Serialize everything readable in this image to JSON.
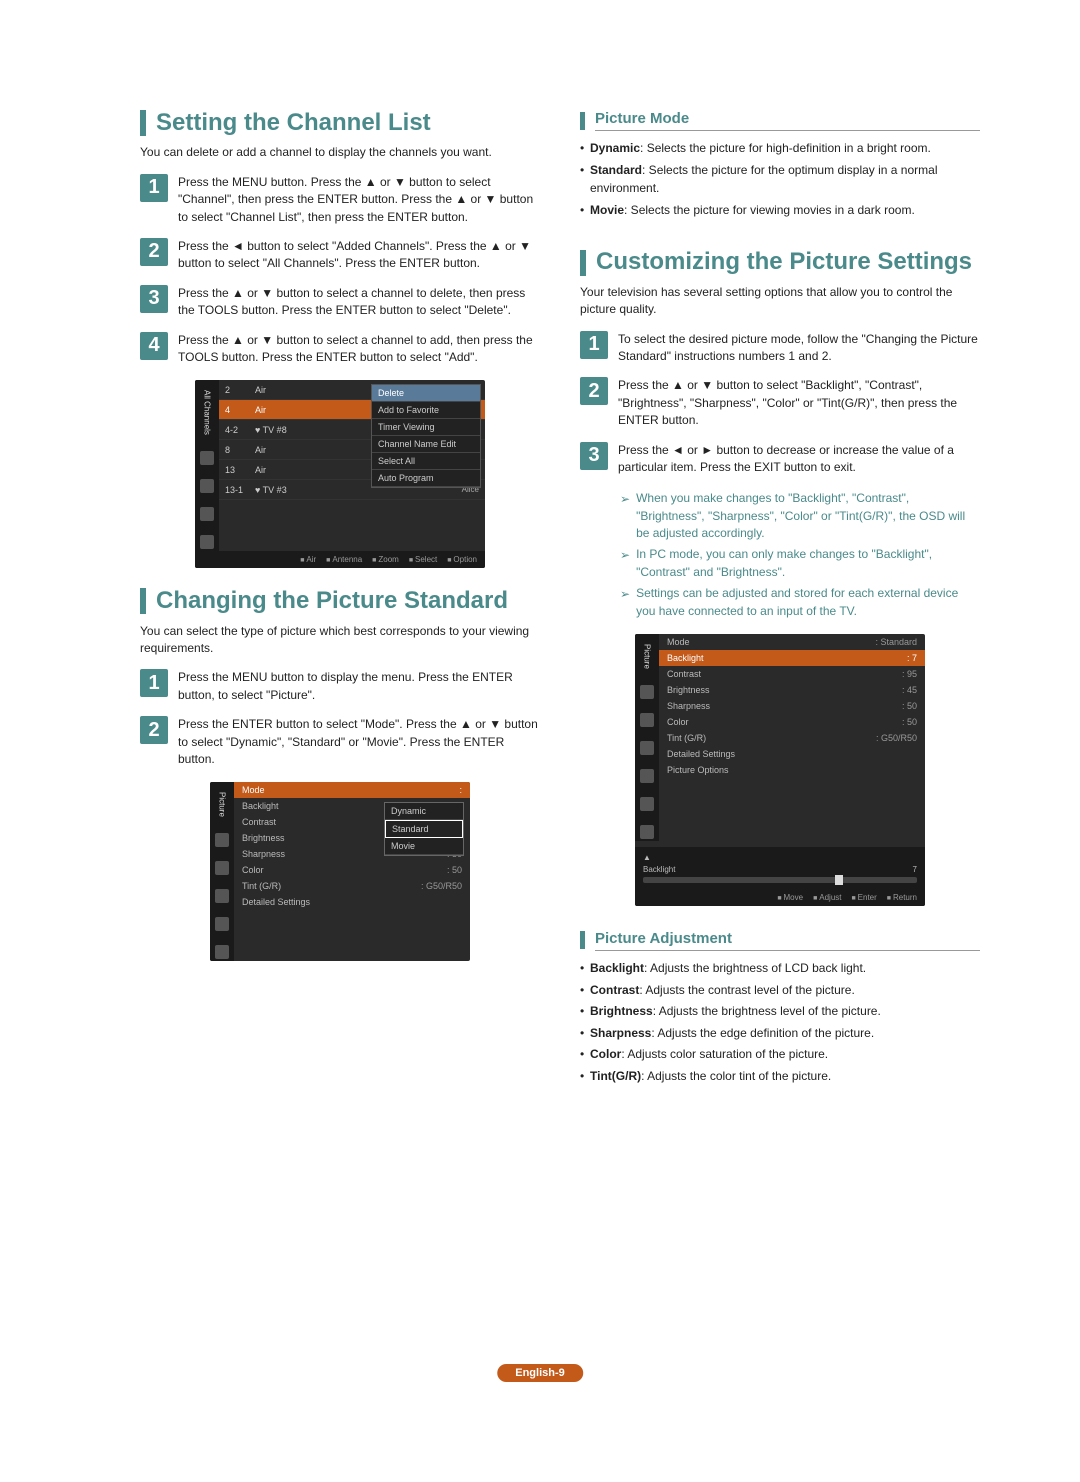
{
  "left": {
    "section1": {
      "title": "Setting the Channel List",
      "intro": "You can delete or add a channel to display the channels you want.",
      "steps": [
        "Press the MENU button. Press the ▲ or ▼ button to select \"Channel\", then press the ENTER button. Press the ▲ or ▼ button to select \"Channel List\", then press the ENTER button.",
        "Press the ◄ button to select \"Added Channels\". Press the ▲ or ▼ button to select \"All Channels\". Press the ENTER button.",
        "Press the ▲ or ▼ button to select a channel to delete, then press the TOOLS button. Press the ENTER button to select \"Delete\".",
        "Press the ▲ or ▼ button to select a channel to add, then press the TOOLS button. Press the ENTER button to select \"Add\"."
      ],
      "osd": {
        "side_label": "All Channels",
        "rows": [
          {
            "c1": "2",
            "c2": "Air",
            "c3": ""
          },
          {
            "c1": "4",
            "c2": "Air",
            "c3": "",
            "hl": true
          },
          {
            "c1": "4-2",
            "c2": "♥ TV #8",
            "c3": ""
          },
          {
            "c1": "8",
            "c2": "Air",
            "c3": ""
          },
          {
            "c1": "13",
            "c2": "Air",
            "c3": ""
          },
          {
            "c1": "13-1",
            "c2": "♥ TV #3",
            "c3": "Alice"
          }
        ],
        "menu": [
          "Delete",
          "Add to Favorite",
          "Timer Viewing",
          "Channel Name Edit",
          "Select All",
          "Auto Program"
        ],
        "footer": [
          "Air",
          "Antenna",
          "Zoom",
          "Select",
          "Option"
        ]
      }
    },
    "section2": {
      "title": "Changing the Picture Standard",
      "intro": "You can select the type of picture which best corresponds to your viewing requirements.",
      "steps": [
        "Press the MENU button to display the menu. Press the ENTER button, to select \"Picture\".",
        "Press the ENTER button to select \"Mode\". Press the ▲ or ▼ button to select \"Dynamic\", \"Standard\" or \"Movie\". Press the ENTER button."
      ],
      "osd": {
        "side_label": "Picture",
        "header": "Mode",
        "rows": [
          {
            "lbl": "Backlight",
            "val": ""
          },
          {
            "lbl": "Contrast",
            "val": ""
          },
          {
            "lbl": "Brightness",
            "val": ""
          },
          {
            "lbl": "Sharpness",
            "val": ": 50"
          },
          {
            "lbl": "Color",
            "val": ": 50"
          },
          {
            "lbl": "Tint (G/R)",
            "val": ": G50/R50"
          },
          {
            "lbl": "Detailed Settings",
            "val": ""
          }
        ],
        "dropdown": [
          "Dynamic",
          "Standard",
          "Movie"
        ]
      }
    }
  },
  "right": {
    "sub1": {
      "title": "Picture Mode",
      "items": [
        {
          "term": "Dynamic",
          "desc": ": Selects the picture for high-definition in a bright room."
        },
        {
          "term": "Standard",
          "desc": ": Selects the picture for the optimum display in a normal environment."
        },
        {
          "term": "Movie",
          "desc": ": Selects the picture for viewing movies in a dark room."
        }
      ]
    },
    "section3": {
      "title": "Customizing the Picture Settings",
      "intro": "Your television has several setting options that allow you to control the picture quality.",
      "steps": [
        "To select the desired picture mode, follow the \"Changing the Picture Standard\" instructions numbers 1 and 2.",
        "Press the ▲ or ▼ button to select \"Backlight\", \"Contrast\", \"Brightness\", \"Sharpness\", \"Color\" or \"Tint(G/R)\", then press the ENTER button.",
        "Press the ◄ or ► button to decrease or increase the value of a particular item. Press the EXIT button to exit."
      ],
      "notes": [
        "When you make changes to \"Backlight\", \"Contrast\", \"Brightness\", \"Sharpness\", \"Color\" or \"Tint(G/R)\", the OSD will be adjusted accordingly.",
        "In PC mode, you can only make changes to \"Backlight\", \"Contrast\" and \"Brightness\".",
        "Settings can be adjusted and stored for each external device you have connected to an input of the TV."
      ],
      "osd": {
        "side_label": "Picture",
        "rows": [
          {
            "lbl": "Mode",
            "val": ": Standard"
          },
          {
            "lbl": "Backlight",
            "val": ": 7",
            "hl": true
          },
          {
            "lbl": "Contrast",
            "val": ": 95"
          },
          {
            "lbl": "Brightness",
            "val": ": 45"
          },
          {
            "lbl": "Sharpness",
            "val": ": 50"
          },
          {
            "lbl": "Color",
            "val": ": 50"
          },
          {
            "lbl": "Tint (G/R)",
            "val": ": G50/R50"
          },
          {
            "lbl": "Detailed Settings",
            "val": ""
          },
          {
            "lbl": "Picture Options",
            "val": ""
          }
        ],
        "slider": {
          "label": "Backlight",
          "value": "7",
          "pct": 70
        },
        "footer": [
          "Move",
          "Adjust",
          "Enter",
          "Return"
        ]
      }
    },
    "sub2": {
      "title": "Picture Adjustment",
      "items": [
        {
          "term": "Backlight",
          "desc": ": Adjusts the brightness of LCD back light."
        },
        {
          "term": "Contrast",
          "desc": ": Adjusts the contrast level of the picture."
        },
        {
          "term": "Brightness",
          "desc": ": Adjusts the brightness level of the picture."
        },
        {
          "term": "Sharpness",
          "desc": ": Adjusts the edge definition of the picture."
        },
        {
          "term": "Color",
          "desc": ": Adjusts color saturation of the picture."
        },
        {
          "term": "Tint(G/R)",
          "desc": ": Adjusts the color tint of the picture."
        }
      ]
    }
  },
  "footer": "English-9"
}
